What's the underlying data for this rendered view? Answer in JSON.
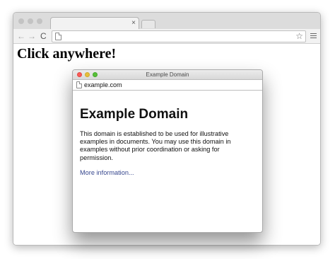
{
  "browser": {
    "tab": {
      "title": "",
      "close_glyph": "×"
    },
    "toolbar": {
      "back_glyph": "←",
      "forward_glyph": "→",
      "reload_glyph": "C",
      "address_value": "",
      "bookmark_glyph": "☆"
    },
    "page": {
      "heading": "Click anywhere!"
    }
  },
  "popup": {
    "window_title": "Example Domain",
    "address": "example.com",
    "content": {
      "title": "Example Domain",
      "paragraph": "This domain is established to be used for illustrative examples in documents. You may use this domain in examples without prior coordination or asking for permission.",
      "link": "More information..."
    }
  },
  "colors": {
    "link": "#38488f",
    "close_dot": "#fc5b57",
    "minimize_dot": "#e5bf3c",
    "maximize_dot": "#57c038"
  },
  "icons": [
    "back-icon",
    "forward-icon",
    "reload-icon",
    "page-icon",
    "star-icon",
    "menu-icon",
    "close-icon"
  ]
}
